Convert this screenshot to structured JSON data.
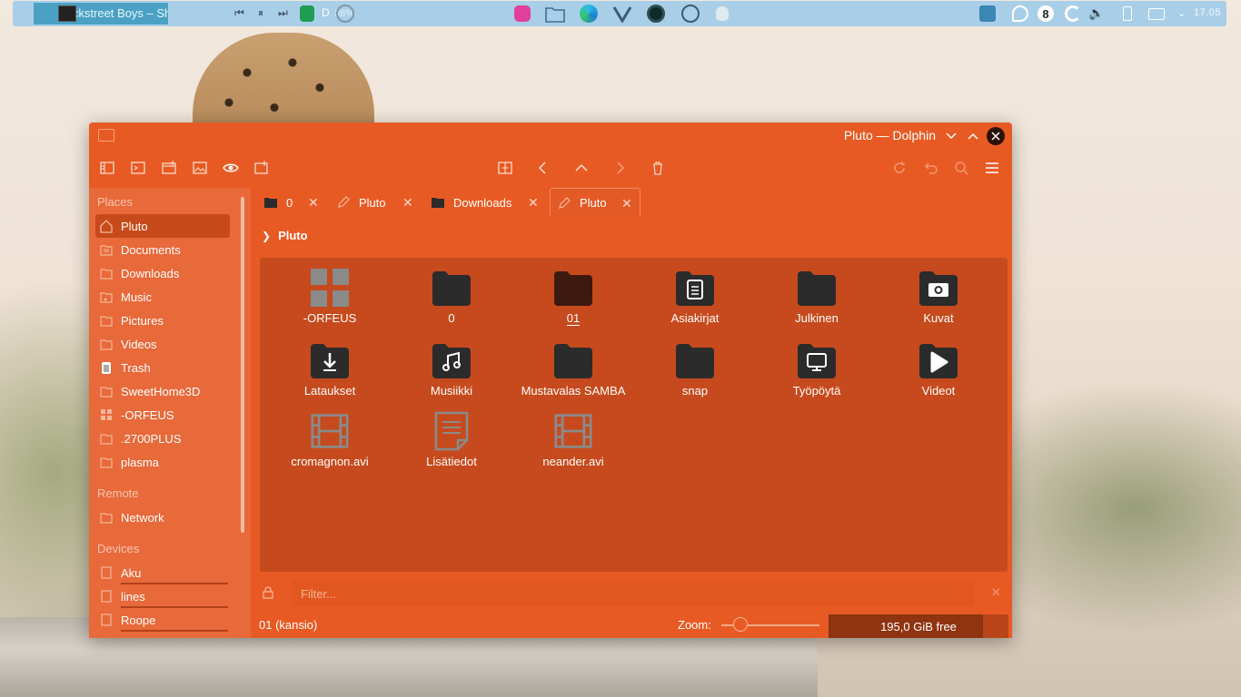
{
  "panel": {
    "media_title": "Backstreet Boys – Shape Of M...",
    "media_extra": "D",
    "media_percent": "38%",
    "clock": "17.05",
    "tray_badge": "8"
  },
  "window": {
    "title": "Pluto — Dolphin"
  },
  "sidebar": {
    "places_heading": "Places",
    "places": [
      {
        "label": "Pluto",
        "icon": "home-icon"
      },
      {
        "label": "Documents",
        "icon": "documents-icon"
      },
      {
        "label": "Downloads",
        "icon": "downloads-icon"
      },
      {
        "label": "Music",
        "icon": "music-icon"
      },
      {
        "label": "Pictures",
        "icon": "pictures-icon"
      },
      {
        "label": "Videos",
        "icon": "videos-icon"
      },
      {
        "label": "Trash",
        "icon": "trash-icon"
      },
      {
        "label": "SweetHome3D",
        "icon": "folder-icon"
      },
      {
        "label": "-ORFEUS",
        "icon": "grid-icon"
      },
      {
        "label": ".2700PLUS",
        "icon": "folder-icon"
      },
      {
        "label": "plasma",
        "icon": "folder-icon"
      }
    ],
    "remote_heading": "Remote",
    "remote": [
      {
        "label": "Network",
        "icon": "network-icon"
      }
    ],
    "devices_heading": "Devices",
    "devices": [
      {
        "label": "Aku",
        "icon": "drive-icon"
      },
      {
        "label": "lines",
        "icon": "drive-icon"
      },
      {
        "label": "Roope",
        "icon": "drive-icon"
      }
    ]
  },
  "tabs": [
    {
      "label": "0",
      "icon": "folder-icon"
    },
    {
      "label": "Pluto",
      "icon": "edit-icon"
    },
    {
      "label": "Downloads",
      "icon": "folder-icon"
    },
    {
      "label": "Pluto",
      "icon": "edit-icon",
      "active": true
    }
  ],
  "breadcrumb": {
    "label": "Pluto"
  },
  "files": [
    {
      "name": "-ORFEUS",
      "icon": "grid-icon"
    },
    {
      "name": "0",
      "icon": "folder-icon"
    },
    {
      "name": "01",
      "icon": "folder-icon",
      "selected": true
    },
    {
      "name": "Asiakirjat",
      "icon": "documents-folder-icon"
    },
    {
      "name": "Julkinen",
      "icon": "folder-icon"
    },
    {
      "name": "Kuvat",
      "icon": "pictures-folder-icon"
    },
    {
      "name": "Lataukset",
      "icon": "downloads-folder-icon"
    },
    {
      "name": "Musiikki",
      "icon": "music-folder-icon"
    },
    {
      "name": "Mustavalas SAMBA",
      "icon": "folder-icon"
    },
    {
      "name": "snap",
      "icon": "folder-icon"
    },
    {
      "name": "Työpöytä",
      "icon": "desktop-folder-icon"
    },
    {
      "name": "Videot",
      "icon": "videos-folder-icon"
    },
    {
      "name": "cromagnon.avi",
      "icon": "video-file-icon"
    },
    {
      "name": "Lisätiedot",
      "icon": "text-file-icon"
    },
    {
      "name": "neander.avi",
      "icon": "video-file-icon"
    }
  ],
  "filter": {
    "placeholder": "Filter..."
  },
  "status": {
    "selection": "01 (kansio)",
    "zoom_label": "Zoom:",
    "free_space": "195,0 GiB free",
    "zoom_level": 0.15,
    "used_fraction": 0.86
  },
  "colors": {
    "window_bg": "#e85a24",
    "view_bg": "#c64a1d",
    "panel_bg": "#a9cfe8",
    "icon_dark": "#2b2b2b"
  }
}
